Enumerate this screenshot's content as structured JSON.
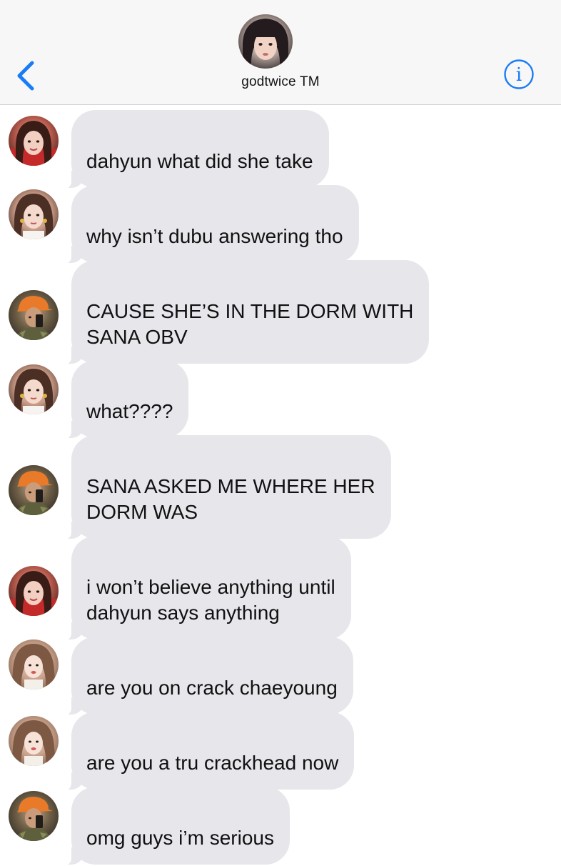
{
  "header": {
    "title": "godtwice TM",
    "back_icon": "chevron-left-icon",
    "info_icon": "info-circle-icon",
    "accent_color": "#1a7cf5",
    "group_avatar": "profile-photo"
  },
  "colors": {
    "incoming_bubble": "#e6e6eb",
    "header_background": "#f7f7f8",
    "text": "#111111"
  },
  "messages": [
    {
      "sender_avatar": "profile-photo-a",
      "text": "dahyun what did she take"
    },
    {
      "sender_avatar": "profile-photo-b",
      "text": "why isn’t dubu answering tho"
    },
    {
      "sender_avatar": "profile-photo-c",
      "text": "CAUSE SHE’S IN THE DORM WITH\nSANA OBV"
    },
    {
      "sender_avatar": "profile-photo-b",
      "text": "what????"
    },
    {
      "sender_avatar": "profile-photo-c",
      "text": "SANA ASKED ME WHERE HER\nDORM WAS"
    },
    {
      "sender_avatar": "profile-photo-a",
      "text": "i won’t believe anything until\ndahyun says anything"
    },
    {
      "sender_avatar": "profile-photo-d",
      "text": "are you on crack chaeyoung"
    },
    {
      "sender_avatar": "profile-photo-d",
      "text": "are you a tru crackhead now"
    },
    {
      "sender_avatar": "profile-photo-c",
      "text": "omg guys i’m serious"
    }
  ]
}
